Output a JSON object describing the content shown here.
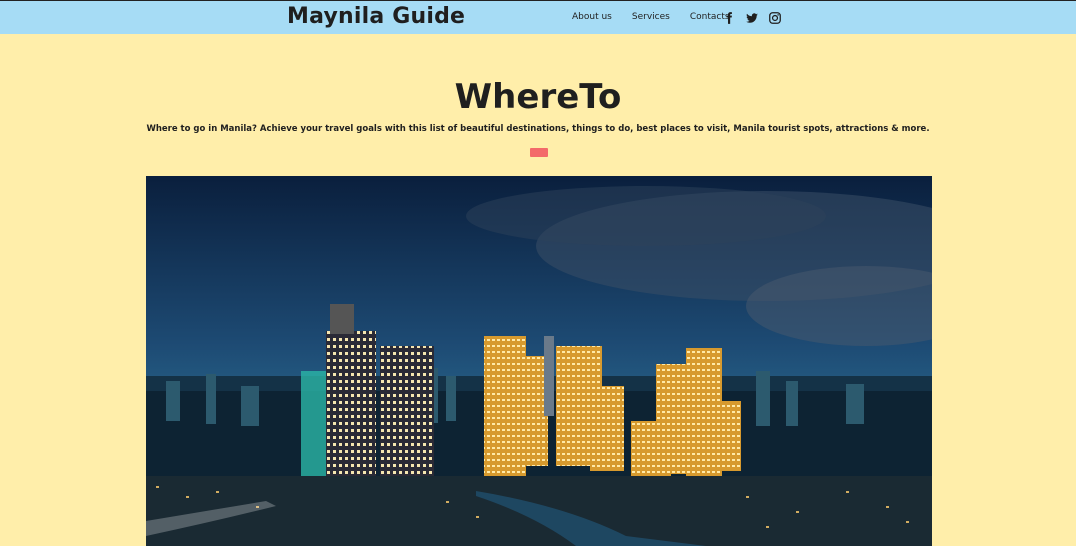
{
  "header": {
    "brand": "Maynila Guide",
    "nav": [
      "About us",
      "Services",
      "Contacts"
    ],
    "social_icons": [
      "facebook-icon",
      "twitter-icon",
      "instagram-icon"
    ],
    "colors": {
      "topbar": "#A6DCF5",
      "page_bg": "#FFEEAA"
    }
  },
  "hero": {
    "title": "WhereTo",
    "subtitle": "Where to go in Manila? Achieve your travel goals with this list of beautiful destinations, things to do, best places to visit, Manila tourist spots, attractions & more.",
    "accent_color": "#F36A6A"
  },
  "image": {
    "subject": "Manila skyline at night"
  }
}
